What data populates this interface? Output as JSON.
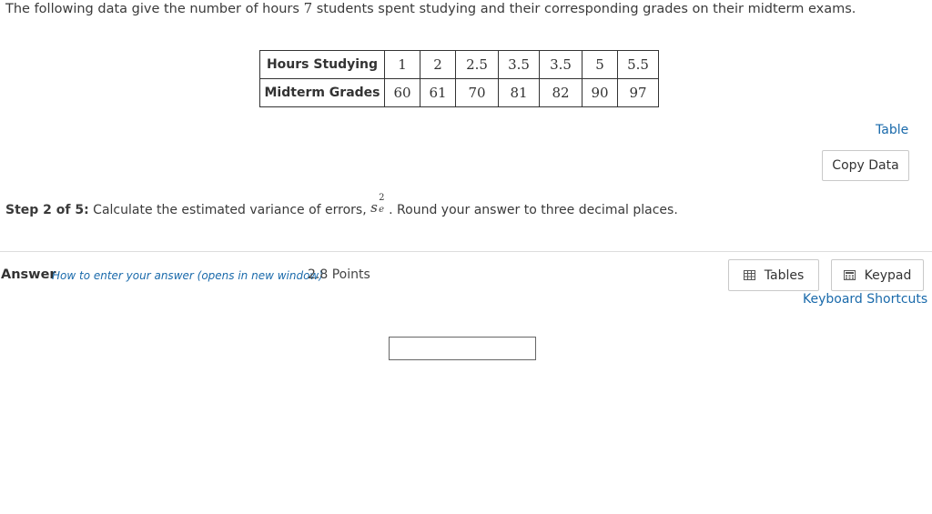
{
  "question": {
    "prompt_before": "The following data give the number of hours ",
    "prompt_count": "7",
    "prompt_after": " students spent studying and their corresponding grades on their midterm exams."
  },
  "data_table": {
    "rows": [
      {
        "header": "Hours Studying",
        "values": [
          "1",
          "2",
          "2.5",
          "3.5",
          "3.5",
          "5",
          "5.5"
        ]
      },
      {
        "header": "Midterm Grades",
        "values": [
          "60",
          "61",
          "70",
          "81",
          "82",
          "90",
          "97"
        ]
      }
    ]
  },
  "links": {
    "table": "Table",
    "how_to": "How to enter your answer (opens in new window)",
    "keyboard_shortcuts": "Keyboard Shortcuts"
  },
  "buttons": {
    "copy_data": "Copy Data",
    "tables": "Tables",
    "keypad": "Keypad"
  },
  "step": {
    "label": "Step 2 of 5:",
    "text_before": " Calculate the estimated variance of errors, ",
    "math_base": "s",
    "math_sup": "2",
    "math_sub": "e",
    "text_after": ". Round your answer to three decimal places."
  },
  "answer": {
    "label": "Answer",
    "points": "2.8 Points",
    "value": ""
  },
  "icons": {
    "tables": "grid-table-icon",
    "keypad": "calculator-icon"
  },
  "colors": {
    "link": "#1a6aab",
    "text": "#333333",
    "border": "#c9c9c9"
  }
}
